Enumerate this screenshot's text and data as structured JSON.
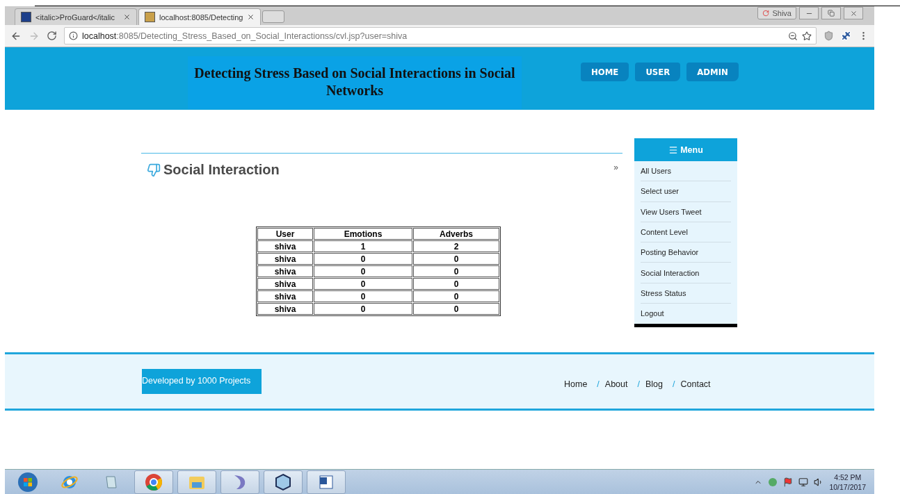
{
  "browser": {
    "tabs": [
      {
        "title": "<italic>ProGuard</italic",
        "selected": false
      },
      {
        "title": "localhost:8085/Detecting",
        "selected": true
      }
    ],
    "profile": "Shiva",
    "url_host": "localhost",
    "url_rest": ":8085/Detecting_Stress_Based_on_Social_Interactionss/cvl.jsp?user=shiva"
  },
  "header": {
    "title": "Detecting Stress Based on Social Interactions in Social Networks",
    "nav": [
      "HOME",
      "USER",
      "ADMIN"
    ]
  },
  "content": {
    "heading": "Social Interaction",
    "more": "»",
    "table": {
      "columns": [
        "User",
        "Emotions",
        "Adverbs"
      ],
      "rows": [
        [
          "shiva",
          "1",
          "2"
        ],
        [
          "shiva",
          "0",
          "0"
        ],
        [
          "shiva",
          "0",
          "0"
        ],
        [
          "shiva",
          "0",
          "0"
        ],
        [
          "shiva",
          "0",
          "0"
        ],
        [
          "shiva",
          "0",
          "0"
        ]
      ]
    }
  },
  "menu": {
    "title": "Menu",
    "items": [
      "All Users",
      "Select user",
      "View Users Tweet",
      "Content Level",
      "Posting Behavior",
      "Social Interaction",
      "Stress Status",
      "Logout"
    ]
  },
  "footer": {
    "credit": "Developed by 1000 Projects",
    "separator": "/",
    "links": [
      "Home",
      "About",
      "Blog",
      "Contact"
    ]
  },
  "taskbar": {
    "time": "4:52 PM",
    "date": "10/17/2017"
  }
}
